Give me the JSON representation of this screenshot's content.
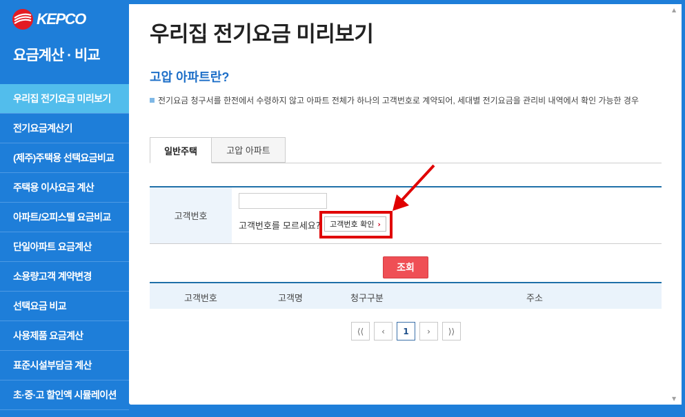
{
  "brand": {
    "logo_text": "KEPCO",
    "section_title": "요금계산 · 비교"
  },
  "sidebar": {
    "items": [
      {
        "label": "우리집 전기요금 미리보기",
        "active": true
      },
      {
        "label": "전기요금계산기"
      },
      {
        "label": "(제주)주택용 선택요금비교"
      },
      {
        "label": "주택용 이사요금 계산"
      },
      {
        "label": "아파트/오피스텔 요금비교"
      },
      {
        "label": "단일아파트 요금계산"
      },
      {
        "label": "소용량고객 계약변경"
      },
      {
        "label": "선택요금 비교"
      },
      {
        "label": "사용제품 요금계산"
      },
      {
        "label": "표준시설부담금 계산"
      },
      {
        "label": "초·중·고 할인액 시뮬레이션"
      }
    ]
  },
  "main": {
    "title": "우리집 전기요금 미리보기",
    "subtitle": "고압 아파트란?",
    "description": "전기요금 청구서를 한전에서 수령하지 않고 아파트 전체가 하나의 고객번호로 계약되어, 세대별 전기요금을 관리비 내역에서 확인 가능한 경우",
    "tabs": [
      {
        "label": "일반주택",
        "active": true
      },
      {
        "label": "고압 아파트"
      }
    ],
    "form": {
      "customer_no_label": "고객번호",
      "customer_no_value": "",
      "hint": "고객번호를 모르세요?",
      "check_button": "고객번호 확인"
    },
    "search_button": "조회",
    "result_columns": [
      "고객번호",
      "고객명",
      "청구구분",
      "주소"
    ],
    "pagination": {
      "first": "⟨⟨",
      "prev": "‹",
      "current": "1",
      "next": "›",
      "last": "⟩⟩"
    }
  },
  "colors": {
    "sidebar_bg": "#1e7ed9",
    "active_item": "#52bdec",
    "accent_red": "#ef4f55",
    "highlight": "#e00000"
  }
}
